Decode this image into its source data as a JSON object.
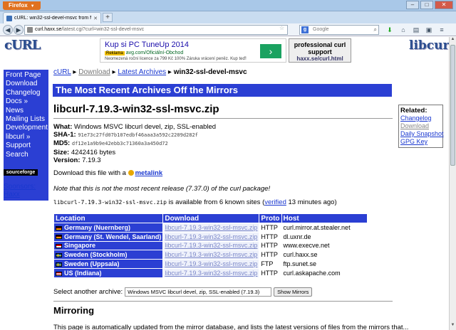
{
  "browser": {
    "app_button": "Firefox",
    "tab_title": "cURL: win32-ssl-devel-msvc from Mirrors",
    "url_host": "curl.haxx.se",
    "url_prefix": "",
    "url_path": "/latest.cgi?curl=win32-ssl-devel-msvc",
    "search_engine": "g",
    "search_placeholder": "Google"
  },
  "header": {
    "logo_left": "cURL",
    "logo_right": "libcurl",
    "ad": {
      "title": "Kup si PC TuneUp 2014",
      "badge": "Reklama",
      "url": "avg.com/Oficiální-Obchod",
      "desc": "Neomezená roční licence za 799 Kč 100% Záruka vrácení peněz. Kup teď!"
    },
    "support": {
      "line1": "professional curl",
      "line2": "support",
      "line3": "haxx.se/curl.html"
    }
  },
  "sidebar": {
    "items": [
      "Front Page",
      "Download",
      "Changelog",
      "Docs »",
      "News",
      "Mailing Lists",
      "Development »",
      "libcurl »",
      "Support",
      "Search"
    ],
    "badge": "sourceforge",
    "sponsors_label": "Sponsors:",
    "sponsor": "Haxx"
  },
  "breadcrumb": {
    "root": "cURL",
    "sep": "▸",
    "download": "Download",
    "latest": "Latest Archives",
    "current": "win32-ssl-devel-msvc"
  },
  "banner": "The Most Recent Archives Off the Mirrors",
  "package": {
    "title": "libcurl-7.19.3-win32-ssl-msvc.zip",
    "what_label": "What:",
    "what": "Windows MSVC libcurl devel, zip, SSL-enabled",
    "sha1_label": "SHA-1:",
    "sha1": "91e73c27fd07b107edbf46aaa3a592c2209d282f",
    "md5_label": "MD5:",
    "md5": "df12e1a9b9e42ebb3c71360a3a450d72",
    "size_label": "Size:",
    "size": "4242416 bytes",
    "version_label": "Version:",
    "version": "7.19.3"
  },
  "related": {
    "title": "Related:",
    "items": [
      {
        "label": "Changelog",
        "disabled": false
      },
      {
        "label": "Download",
        "disabled": true
      },
      {
        "label": "Daily Snapshot",
        "disabled": false
      },
      {
        "label": "GPG Key",
        "disabled": false
      }
    ]
  },
  "download_line": {
    "prefix": "Download this file with a",
    "link": "metalink"
  },
  "note": "Note that this is not the most recent release (7.37.0) of the curl package!",
  "availability": {
    "file": "libcurl-7.19.3-win32-ssl-msvc.zip",
    "text": "is available from 6 known sites (",
    "verified": "verified",
    "age": "13 minutes ago)"
  },
  "mirrors": {
    "headers": [
      "Location",
      "Download",
      "Proto",
      "Host"
    ],
    "rows": [
      {
        "flag": "de",
        "location": "Germany (Nuernberg)",
        "file": "libcurl-7.19.3-win32-ssl-msvc.zip",
        "proto": "HTTP",
        "host": "curl.mirror.at.stealer.net"
      },
      {
        "flag": "de",
        "location": "Germany (St. Wendel, Saarland)",
        "file": "libcurl-7.19.3-win32-ssl-msvc.zip",
        "proto": "HTTP",
        "host": "dl.uxnr.de"
      },
      {
        "flag": "sg",
        "location": "Singapore",
        "file": "libcurl-7.19.3-win32-ssl-msvc.zip",
        "proto": "HTTP",
        "host": "www.execve.net"
      },
      {
        "flag": "se",
        "location": "Sweden (Stockholm)",
        "file": "libcurl-7.19.3-win32-ssl-msvc.zip",
        "proto": "HTTP",
        "host": "curl.haxx.se"
      },
      {
        "flag": "se",
        "location": "Sweden (Uppsala)",
        "file": "libcurl-7.19.3-win32-ssl-msvc.zip",
        "proto": "FTP",
        "host": "ftp.sunet.se"
      },
      {
        "flag": "us",
        "location": "US (Indiana)",
        "file": "libcurl-7.19.3-win32-ssl-msvc.zip",
        "proto": "HTTP",
        "host": "curl.askapache.com"
      }
    ]
  },
  "select_archive": {
    "label": "Select another archive:",
    "selected": "Windows MSVC libcurl devel, zip, SSL-enabled (7.19.3)",
    "button": "Show Mirrors"
  },
  "mirroring_title": "Mirroring",
  "cut_text": "This page is automatically updated from the mirror database, and lists the latest versions of files from the mirrors that..."
}
